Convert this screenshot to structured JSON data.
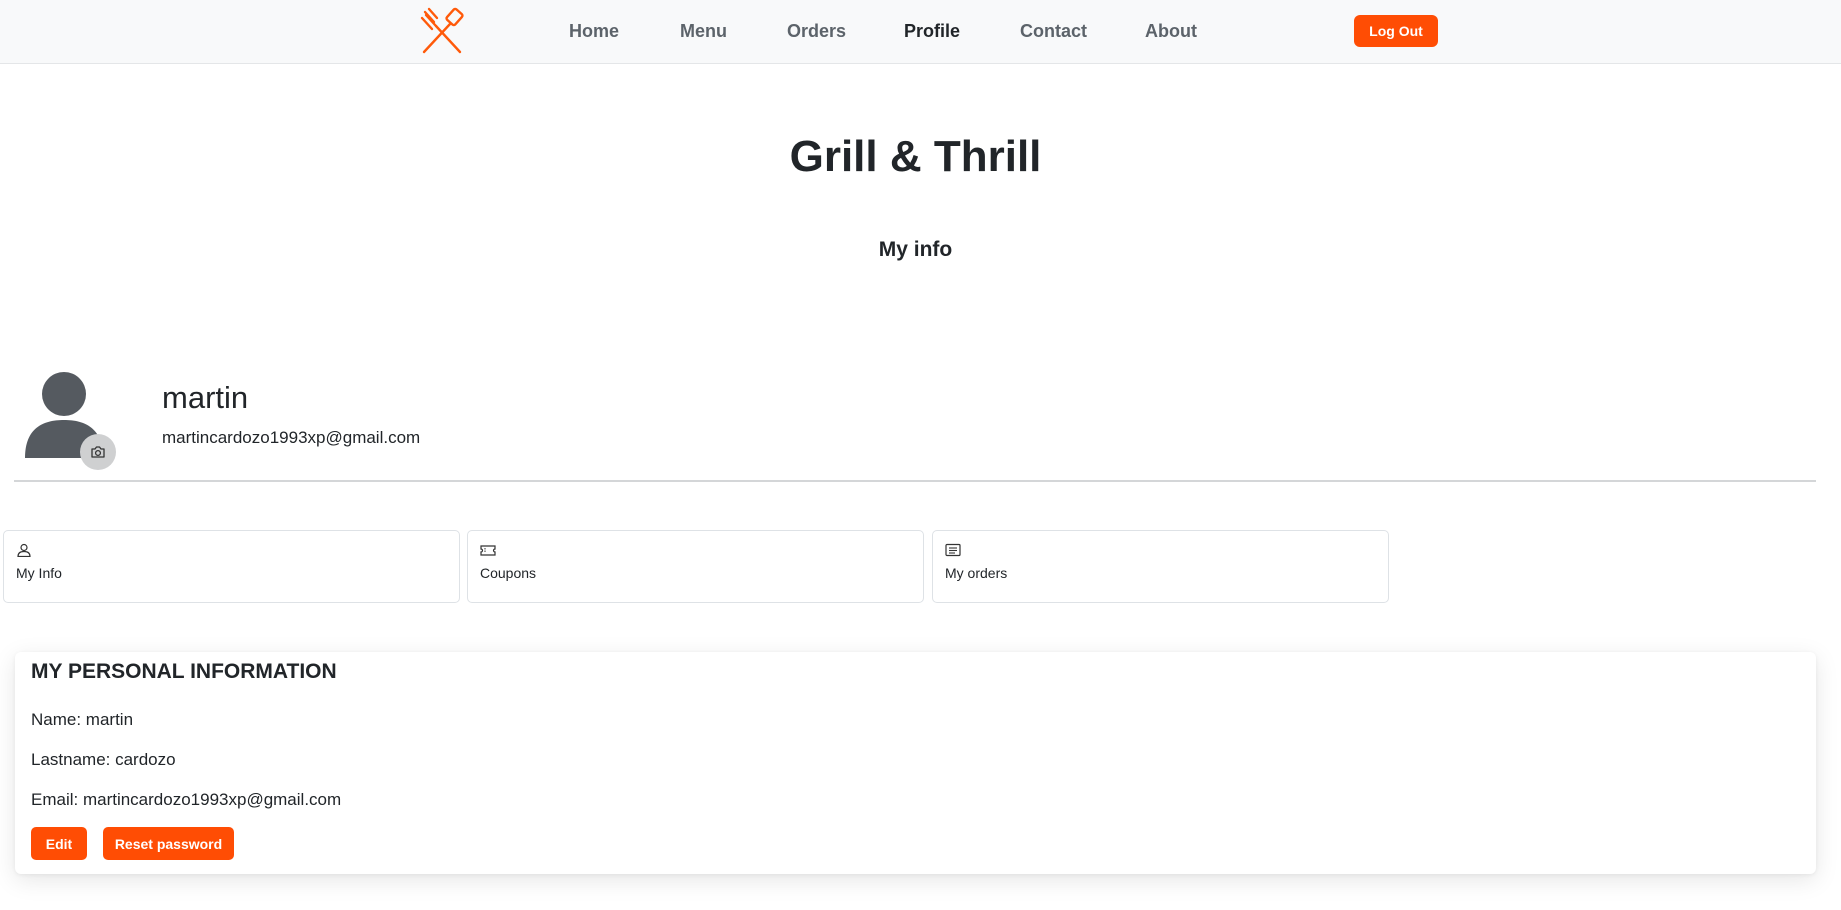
{
  "nav": {
    "logo_icon": "crossed-fork-spatula-icon",
    "accent_color": "#ff4d04",
    "links": [
      {
        "label": "Home"
      },
      {
        "label": "Menu"
      },
      {
        "label": "Orders"
      },
      {
        "label": "Profile",
        "active": true
      },
      {
        "label": "Contact"
      },
      {
        "label": "About"
      }
    ],
    "logout_label": "Log Out"
  },
  "header": {
    "site_title": "Grill & Thrill",
    "section_title": "My info"
  },
  "profile": {
    "avatar_icon": "user-avatar-icon",
    "camera_icon": "camera-icon",
    "name": "martin",
    "email": "martincardozo1993xp@gmail.com"
  },
  "tabs": [
    {
      "label": "My Info",
      "icon": "person-icon"
    },
    {
      "label": "Coupons",
      "icon": "ticket-icon"
    },
    {
      "label": "My orders",
      "icon": "list-icon"
    }
  ],
  "personal_info": {
    "heading": "MY PERSONAL INFORMATION",
    "name_row": "Name: martin",
    "lastname_row": "Lastname: cardozo",
    "email_row": "Email: martincardozo1993xp@gmail.com",
    "edit_label": "Edit",
    "reset_label": "Reset password"
  }
}
